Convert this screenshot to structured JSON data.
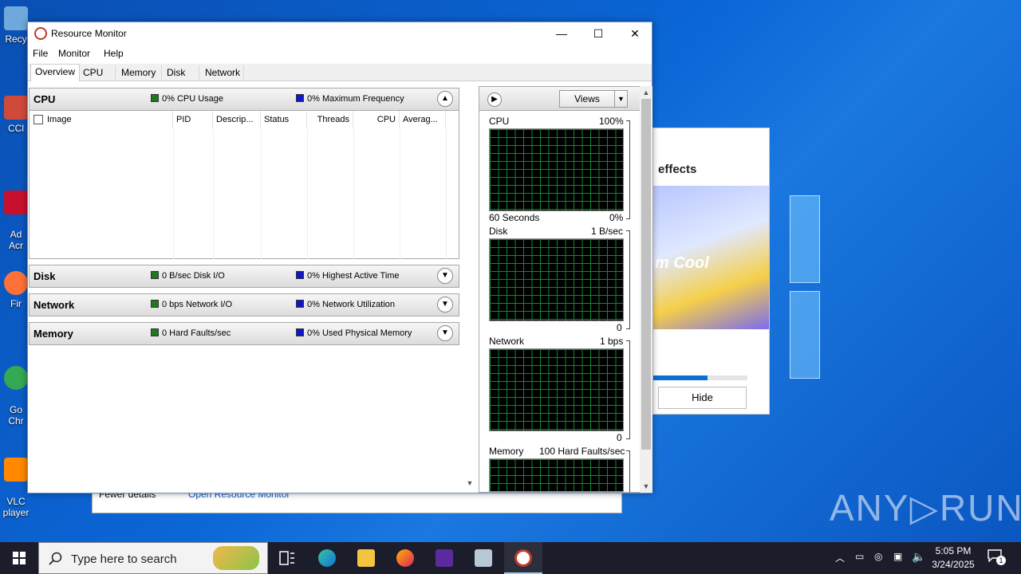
{
  "desktop": {
    "icons": [
      {
        "label": "Recy",
        "color": "#6fa8dc"
      },
      {
        "label": "CCl",
        "color": "#d04a3a"
      },
      {
        "label": "Ad\nAcr",
        "color": "#c8102e"
      },
      {
        "label": "Fir",
        "color": "#ff7139"
      },
      {
        "label": "Go\nChr",
        "color": "#34a853"
      },
      {
        "label": "VLC\nplayer",
        "color": "#ff8800"
      }
    ],
    "watermark": "ANY▷RUN"
  },
  "promo_window": {
    "title": "effects",
    "image_caption": "m Cool",
    "progress_percent": 58,
    "hide_label": "Hide"
  },
  "task_manager_back": {
    "fewer_details": "Fewer details",
    "open_resource_monitor": "Open Resource Monitor"
  },
  "window": {
    "title": "Resource Monitor",
    "minimize": "—",
    "maximize": "☐",
    "close": "✕",
    "menu": [
      "File",
      "Monitor",
      "Help"
    ],
    "tabs": [
      "Overview",
      "CPU",
      "Memory",
      "Disk",
      "Network"
    ]
  },
  "sections": {
    "cpu": {
      "name": "CPU",
      "ind1": "0% CPU Usage",
      "ind2": "0% Maximum Frequency"
    },
    "disk": {
      "name": "Disk",
      "ind1": "0 B/sec Disk I/O",
      "ind2": "0% Highest Active Time"
    },
    "network": {
      "name": "Network",
      "ind1": "0 bps Network I/O",
      "ind2": "0% Network Utilization"
    },
    "memory": {
      "name": "Memory",
      "ind1": "0 Hard Faults/sec",
      "ind2": "0% Used Physical Memory"
    }
  },
  "cpu_table": {
    "columns": [
      "Image",
      "PID",
      "Descrip...",
      "Status",
      "Threads",
      "CPU",
      "Averag..."
    ]
  },
  "right_pane": {
    "views_label": "Views",
    "graphs": [
      {
        "name": "CPU",
        "max": "100%",
        "footer_left": "60 Seconds",
        "footer_right": "0%"
      },
      {
        "name": "Disk",
        "max": "1 B/sec",
        "footer_left": "",
        "footer_right": "0"
      },
      {
        "name": "Network",
        "max": "1 bps",
        "footer_left": "",
        "footer_right": "0"
      },
      {
        "name": "Memory",
        "max": "100 Hard Faults/sec",
        "footer_left": "",
        "footer_right": ""
      }
    ]
  },
  "taskbar": {
    "search_placeholder": "Type here to search",
    "time": "5:05 PM",
    "date": "3/24/2025",
    "notification_count": "1"
  }
}
